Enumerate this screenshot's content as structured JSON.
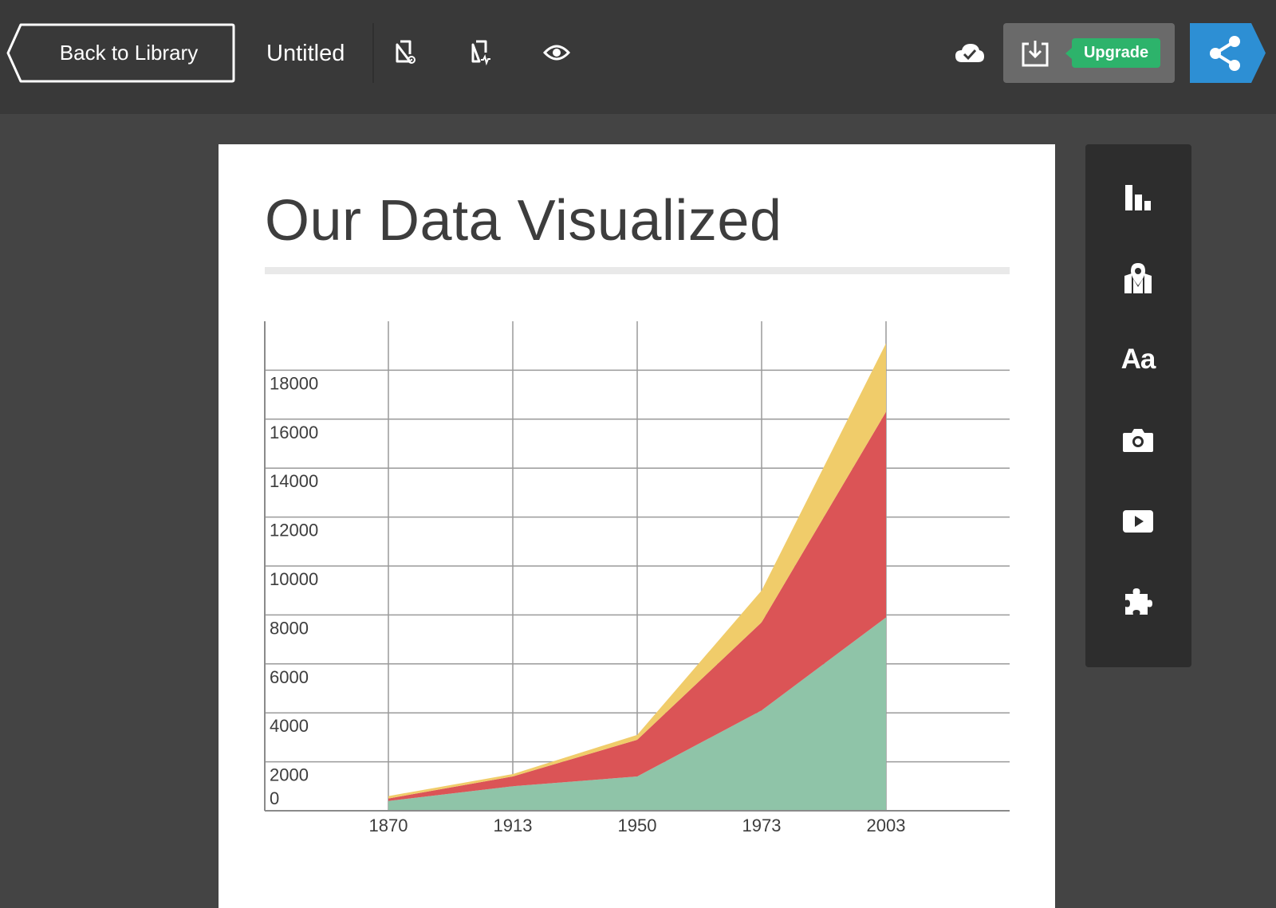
{
  "header": {
    "back_label": "Back to Library",
    "doc_title": "Untitled",
    "upgrade_label": "Upgrade",
    "icons": [
      "document-settings-icon",
      "document-health-icon",
      "preview-eye-icon",
      "cloud-saved-icon",
      "download-icon",
      "share-icon"
    ]
  },
  "page": {
    "title": "Our Data Visualized"
  },
  "tools": [
    "chart-tool-icon",
    "map-tool-icon",
    "text-tool-icon",
    "photo-tool-icon",
    "video-tool-icon",
    "widget-puzzle-icon"
  ],
  "tool_text_glyph": "Aa",
  "colors": {
    "topbar": "#393939",
    "background": "#444444",
    "upgrade": "#2db36b",
    "share": "#2d8fd4",
    "series_green": "#8fc4a8",
    "series_red": "#db5456",
    "series_yellow": "#f0cc6a"
  },
  "chart_data": {
    "type": "area",
    "stacked": true,
    "title": "",
    "xlabel": "",
    "ylabel": "",
    "categories": [
      "1870",
      "1913",
      "1950",
      "1973",
      "2003"
    ],
    "series": [
      {
        "values": [
          400,
          1000,
          1400,
          4100,
          7900
        ]
      },
      {
        "values": [
          100,
          400,
          1500,
          3600,
          8400
        ]
      },
      {
        "values": [
          100,
          100,
          200,
          1300,
          2800
        ]
      }
    ],
    "y_ticks": [
      0,
      2000,
      4000,
      6000,
      8000,
      10000,
      12000,
      14000,
      16000,
      18000
    ],
    "ylim": [
      0,
      20000
    ],
    "grid": true
  }
}
